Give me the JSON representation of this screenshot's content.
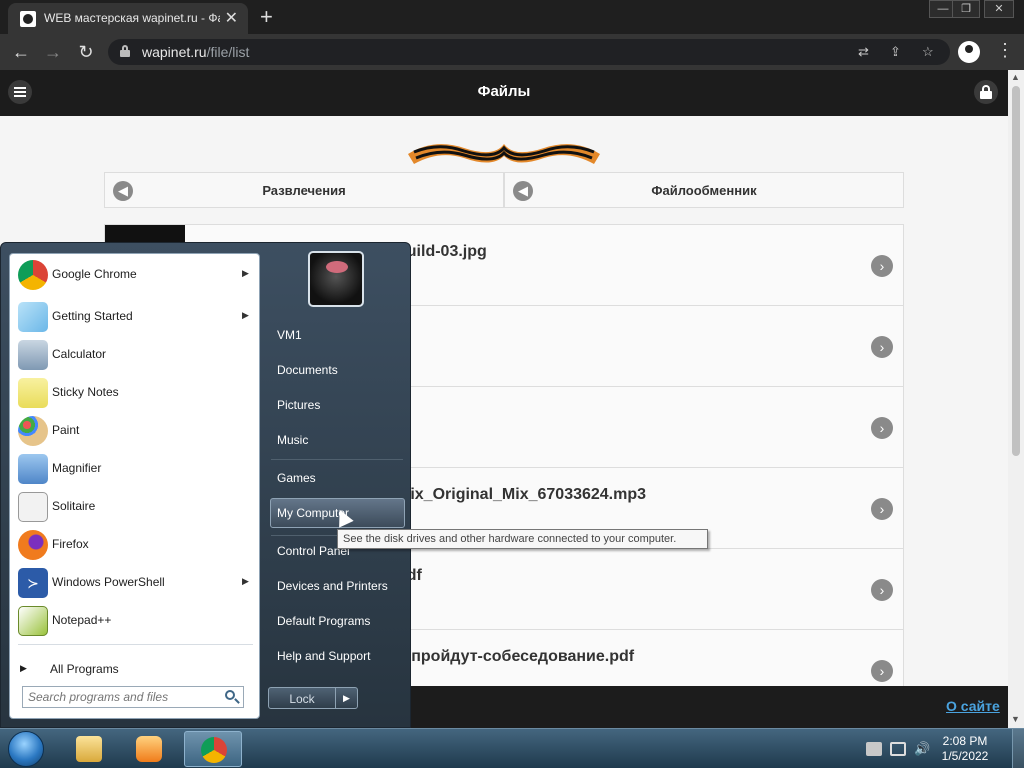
{
  "browser": {
    "tab_title": "WEB мастерская wapinet.ru - Фа",
    "url_host": "wapinet.ru",
    "url_path": "/file/list",
    "new_tab_symbol": "+",
    "window_controls": [
      "—",
      "❐",
      "✕"
    ]
  },
  "site": {
    "header_title": "Файлы",
    "breadcrumbs": [
      {
        "label": "Развлечения"
      },
      {
        "label": "Файлообменник"
      }
    ],
    "files": [
      {
        "name": "build-03.jpg"
      },
      {
        "name": ""
      },
      {
        "name": ""
      },
      {
        "name": "Mix_Original_Mix_67033624.mp3"
      },
      {
        "name": "pdf"
      },
      {
        "name": "е-пройдут-собеседование.pdf"
      }
    ],
    "footer_link": "О сайте"
  },
  "start_menu": {
    "programs": [
      {
        "label": "Google Chrome",
        "icon": "chrome-icon",
        "color": "#e34133",
        "submenu": true
      },
      {
        "label": "Getting Started",
        "icon": "getting-started-icon",
        "color": "#6bb7e8",
        "submenu": true
      },
      {
        "label": "Calculator",
        "icon": "calculator-icon",
        "color": "#7f99b3",
        "submenu": false
      },
      {
        "label": "Sticky Notes",
        "icon": "sticky-notes-icon",
        "color": "#e9dc5a",
        "submenu": false
      },
      {
        "label": "Paint",
        "icon": "paint-icon",
        "color": "#d89b45",
        "submenu": false
      },
      {
        "label": "Magnifier",
        "icon": "magnifier-icon",
        "color": "#4f86c8",
        "submenu": false
      },
      {
        "label": "Solitaire",
        "icon": "solitaire-icon",
        "color": "#f2f2f2",
        "submenu": false
      },
      {
        "label": "Firefox",
        "icon": "firefox-icon",
        "color": "#f07b1e",
        "submenu": false
      },
      {
        "label": "Windows PowerShell",
        "icon": "powershell-icon",
        "color": "#2c5ba8",
        "submenu": true
      },
      {
        "label": "Notepad++",
        "icon": "notepadpp-icon",
        "color": "#9ac23c",
        "submenu": false
      }
    ],
    "all_programs": "All Programs",
    "search_placeholder": "Search programs and files",
    "right_links": [
      {
        "label": "VM1"
      },
      {
        "label": "Documents"
      },
      {
        "label": "Pictures"
      },
      {
        "label": "Music"
      },
      {
        "label": "Games"
      },
      {
        "label": "My Computer"
      },
      {
        "label": "Control Panel"
      },
      {
        "label": "Devices and Printers"
      },
      {
        "label": "Default Programs"
      },
      {
        "label": "Help and Support"
      }
    ],
    "lock_label": "Lock",
    "tooltip": "See the disk drives and other hardware connected to your computer."
  },
  "taskbar": {
    "time": "2:08 PM",
    "date": "1/5/2022"
  }
}
